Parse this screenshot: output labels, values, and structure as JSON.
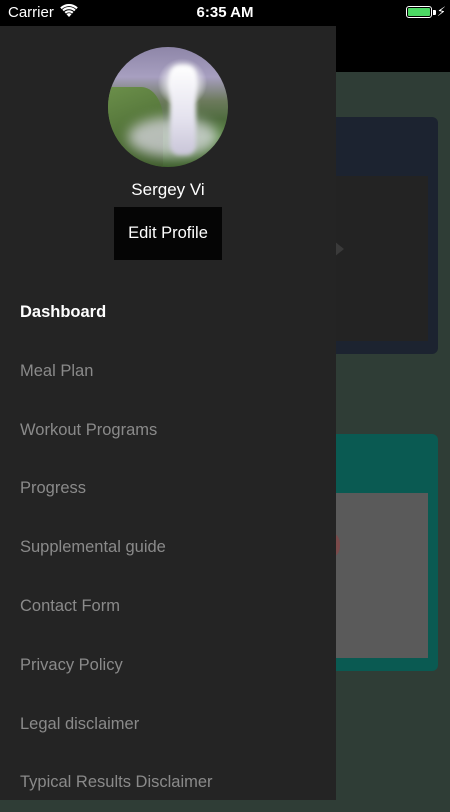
{
  "status_bar": {
    "carrier": "Carrier",
    "time": "6:35 AM",
    "battery_percent": 100
  },
  "profile": {
    "name": "Sergey Vi",
    "edit_label": "Edit Profile"
  },
  "menu": {
    "items": [
      {
        "label": "Dashboard",
        "active": true
      },
      {
        "label": "Meal Plan",
        "active": false
      },
      {
        "label": "Workout Programs",
        "active": false
      },
      {
        "label": "Progress",
        "active": false
      },
      {
        "label": "Supplemental guide",
        "active": false
      },
      {
        "label": "Contact Form",
        "active": false
      },
      {
        "label": "Privacy Policy",
        "active": false
      },
      {
        "label": "Legal disclaimer",
        "active": false
      },
      {
        "label": "Typical Results Disclaimer",
        "active": false
      }
    ]
  },
  "colors": {
    "drawer_bg": "#242424",
    "active_text": "#ffffff",
    "inactive_text": "#8a8a8a",
    "battery": "#4cd964"
  }
}
